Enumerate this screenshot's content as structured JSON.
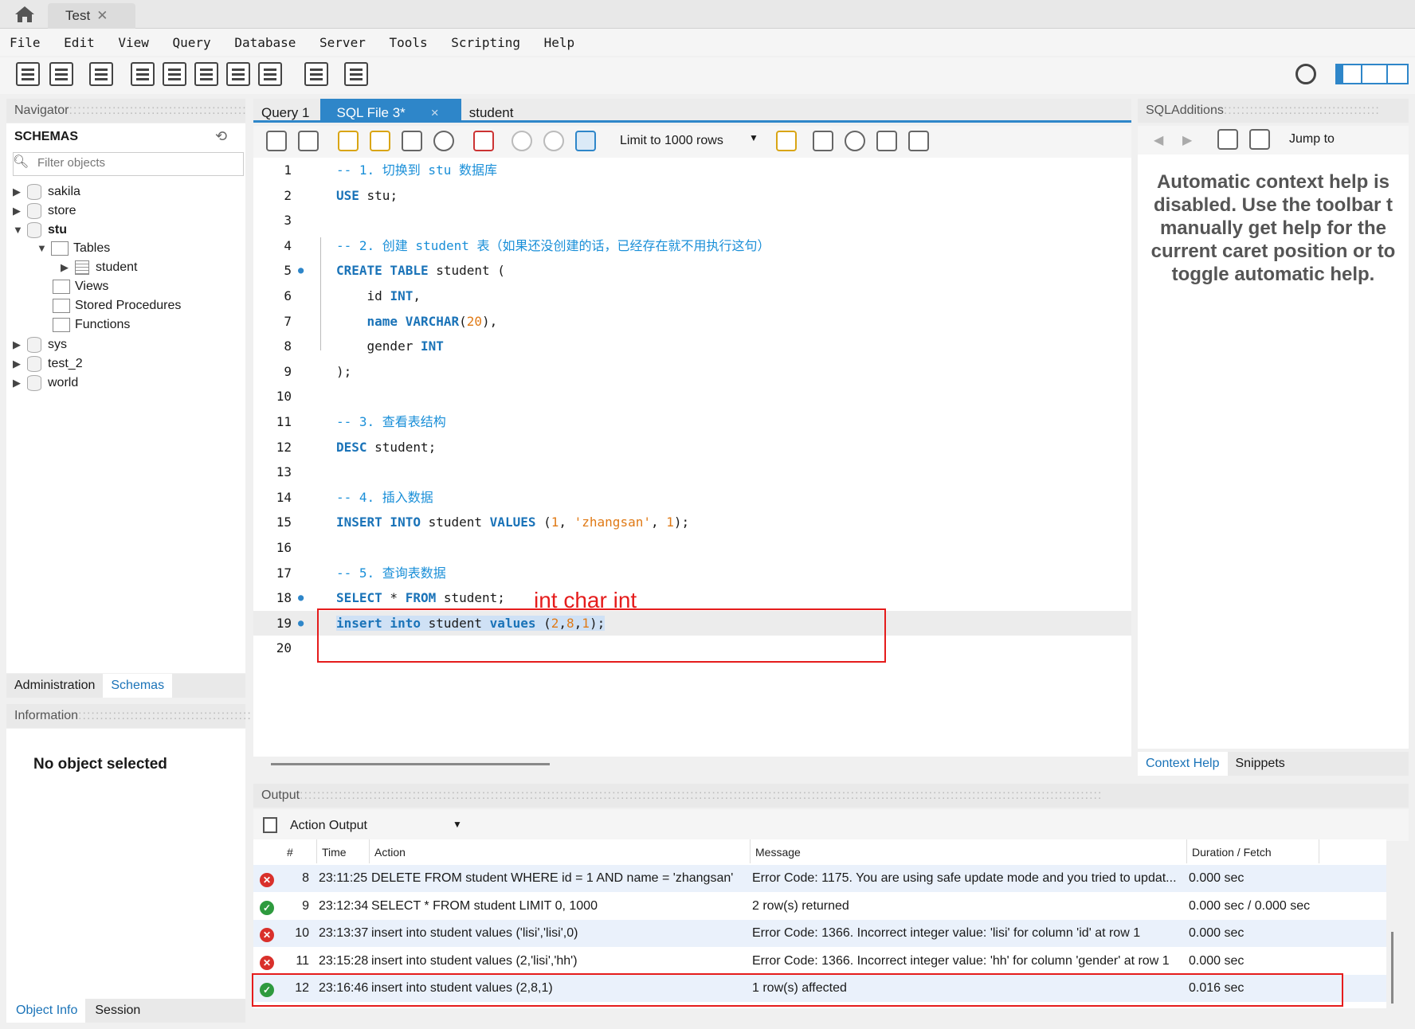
{
  "title_tab": {
    "label": "Test",
    "close": "✕"
  },
  "menu": [
    "File",
    "Edit",
    "View",
    "Query",
    "Database",
    "Server",
    "Tools",
    "Scripting",
    "Help"
  ],
  "navigator": {
    "title": "Navigator",
    "schemas_title": "SCHEMAS",
    "filter_placeholder": "Filter objects",
    "tree": [
      {
        "label": "sakila",
        "arrow": "▶"
      },
      {
        "label": "store",
        "arrow": "▶"
      },
      {
        "label": "stu",
        "arrow": "▼"
      },
      {
        "label": "Tables",
        "arrow": "▼"
      },
      {
        "label": "student",
        "arrow": "▶"
      },
      {
        "label": "Views",
        "arrow": ""
      },
      {
        "label": "Stored Procedures",
        "arrow": ""
      },
      {
        "label": "Functions",
        "arrow": ""
      },
      {
        "label": "sys",
        "arrow": "▶"
      },
      {
        "label": "test_2",
        "arrow": "▶"
      },
      {
        "label": "world",
        "arrow": "▶"
      }
    ],
    "tabs": [
      "Administration",
      "Schemas"
    ]
  },
  "information": {
    "title": "Information",
    "empty": "No object selected",
    "tabs": [
      "Object Info",
      "Session"
    ]
  },
  "editor": {
    "tabs": [
      {
        "label": "Query 1"
      },
      {
        "label": "SQL File 3*"
      },
      {
        "label": "student"
      }
    ],
    "tab_close": "×",
    "limit": "Limit to 1000 rows",
    "lines": [
      {
        "n": "1",
        "mark": "",
        "tokens": [
          [
            "cm",
            "-- 1. 切换到 stu 数据库"
          ]
        ]
      },
      {
        "n": "2",
        "mark": "",
        "tokens": [
          [
            "kw",
            "USE"
          ],
          [
            "",
            " stu;"
          ]
        ]
      },
      {
        "n": "3",
        "mark": "",
        "tokens": []
      },
      {
        "n": "4",
        "mark": "",
        "tokens": [
          [
            "cm",
            "-- 2. 创建 student 表（如果还没创建的话，已经存在就不用执行这句）"
          ]
        ]
      },
      {
        "n": "5",
        "mark": "●",
        "tokens": [
          [
            "kw",
            "CREATE TABLE"
          ],
          [
            "",
            " student ("
          ]
        ]
      },
      {
        "n": "6",
        "mark": "",
        "tokens": [
          [
            "",
            "    id "
          ],
          [
            "kw",
            "INT"
          ],
          [
            "",
            ","
          ]
        ]
      },
      {
        "n": "7",
        "mark": "",
        "tokens": [
          [
            "",
            "    "
          ],
          [
            "kw",
            "name VARCHAR"
          ],
          [
            "",
            "("
          ],
          [
            "num",
            "20"
          ],
          [
            "",
            "),"
          ]
        ]
      },
      {
        "n": "8",
        "mark": "",
        "tokens": [
          [
            "",
            "    gender "
          ],
          [
            "kw",
            "INT"
          ]
        ]
      },
      {
        "n": "9",
        "mark": "",
        "tokens": [
          [
            "",
            ");"
          ]
        ]
      },
      {
        "n": "10",
        "mark": "",
        "tokens": []
      },
      {
        "n": "11",
        "mark": "",
        "tokens": [
          [
            "cm",
            "-- 3. 查看表结构"
          ]
        ]
      },
      {
        "n": "12",
        "mark": "",
        "tokens": [
          [
            "kw",
            "DESC"
          ],
          [
            "",
            " student;"
          ]
        ]
      },
      {
        "n": "13",
        "mark": "",
        "tokens": []
      },
      {
        "n": "14",
        "mark": "",
        "tokens": [
          [
            "cm",
            "-- 4. 插入数据"
          ]
        ]
      },
      {
        "n": "15",
        "mark": "",
        "tokens": [
          [
            "kw",
            "INSERT INTO"
          ],
          [
            "",
            " student "
          ],
          [
            "kw",
            "VALUES"
          ],
          [
            "",
            " ("
          ],
          [
            "num",
            "1"
          ],
          [
            "",
            ", "
          ],
          [
            "str",
            "'zhangsan'"
          ],
          [
            "",
            ", "
          ],
          [
            "num",
            "1"
          ],
          [
            "",
            ");"
          ]
        ]
      },
      {
        "n": "16",
        "mark": "",
        "tokens": []
      },
      {
        "n": "17",
        "mark": "",
        "tokens": [
          [
            "cm",
            "-- 5. 查询表数据"
          ]
        ]
      },
      {
        "n": "18",
        "mark": "●",
        "tokens": [
          [
            "kw",
            "SELECT"
          ],
          [
            "",
            " * "
          ],
          [
            "kw",
            "FROM"
          ],
          [
            "",
            " student;"
          ]
        ]
      },
      {
        "n": "19",
        "mark": "●",
        "tokens": [
          [
            "kw sel",
            "insert into"
          ],
          [
            "sel",
            " student "
          ],
          [
            "kw sel",
            "values"
          ],
          [
            "sel",
            " ("
          ],
          [
            "num sel",
            "2"
          ],
          [
            "sel",
            ","
          ],
          [
            "num sel",
            "8"
          ],
          [
            "sel",
            ","
          ],
          [
            "num sel",
            "1"
          ],
          [
            "sel",
            ");"
          ]
        ]
      },
      {
        "n": "20",
        "mark": "",
        "tokens": []
      }
    ],
    "annotation": "int  char   int"
  },
  "sql_additions": {
    "title": "SQLAdditions",
    "jump_to": "Jump to",
    "help_lines": [
      "Automatic context help is",
      "disabled. Use the toolbar t",
      "manually get help for the",
      "current caret position or to",
      "toggle automatic help."
    ],
    "tabs": [
      "Context Help",
      "Snippets"
    ]
  },
  "output": {
    "title": "Output",
    "selector": "Action Output",
    "columns": [
      "#",
      "Time",
      "Action",
      "Message",
      "Duration / Fetch"
    ],
    "rows": [
      {
        "status": "error",
        "n": "8",
        "time": "23:11:25",
        "action": "DELETE FROM student WHERE id = 1 AND name = 'zhangsan'",
        "message": "Error Code: 1175. You are using safe update mode and you tried to updat...",
        "duration": "0.000 sec"
      },
      {
        "status": "ok",
        "n": "9",
        "time": "23:12:34",
        "action": "SELECT * FROM student LIMIT 0, 1000",
        "message": "2 row(s) returned",
        "duration": "0.000 sec / 0.000 sec"
      },
      {
        "status": "error",
        "n": "10",
        "time": "23:13:37",
        "action": "insert into student values ('lisi','lisi',0)",
        "message": "Error Code: 1366. Incorrect integer value: 'lisi' for column 'id' at row 1",
        "duration": "0.000 sec"
      },
      {
        "status": "error",
        "n": "11",
        "time": "23:15:28",
        "action": "insert into student values (2,'lisi','hh')",
        "message": "Error Code: 1366. Incorrect integer value: 'hh' for column 'gender' at row 1",
        "duration": "0.000 sec"
      },
      {
        "status": "ok",
        "n": "12",
        "time": "23:16:46",
        "action": "insert into student values (2,8,1)",
        "message": "1 row(s) affected",
        "duration": "0.016 sec"
      }
    ]
  },
  "icons": [
    "home-icon",
    "refresh-icon",
    "search-icon",
    "copy-icon",
    "error-icon",
    "ok-icon"
  ]
}
